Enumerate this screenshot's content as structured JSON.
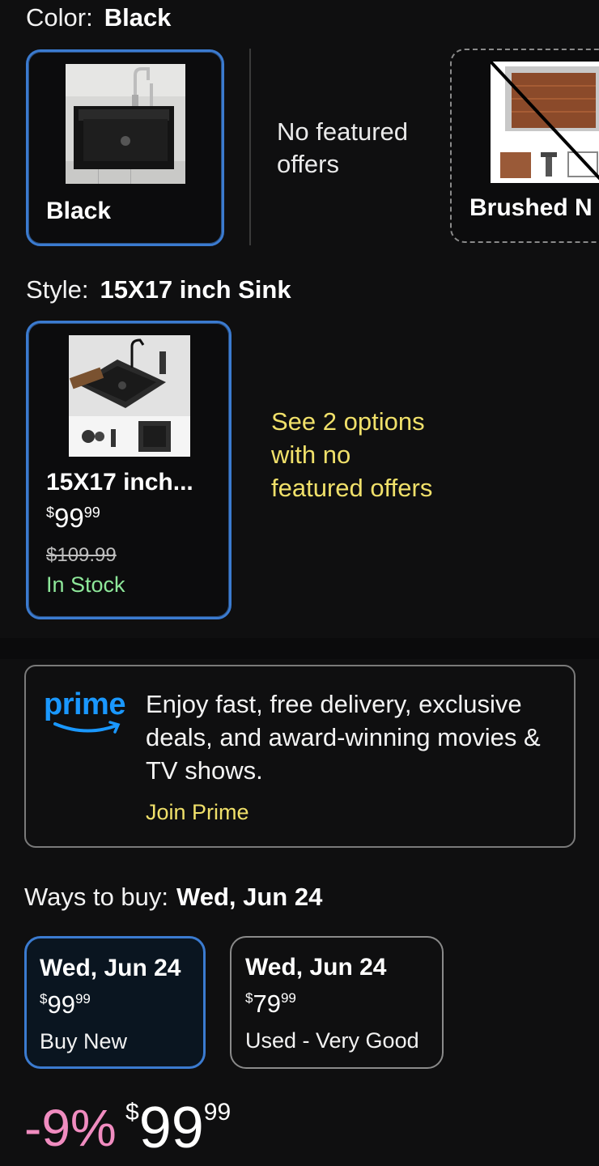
{
  "color": {
    "label": "Color:",
    "selected": "Black",
    "options": [
      {
        "name": "Black"
      },
      {
        "offer_text": "No featured offers"
      },
      {
        "name": "Brushed N"
      }
    ]
  },
  "style": {
    "label": "Style:",
    "selected": "15X17 inch Sink",
    "card": {
      "title": "15X17 inch...",
      "price_dollar": "$",
      "price_whole": "99",
      "price_cents": "99",
      "list_price": "$109.99",
      "availability": "In Stock"
    },
    "see_options": "See 2 options with no featured offers"
  },
  "prime": {
    "logo": "prime",
    "text": "Enjoy fast, free delivery, exclusive deals, and award-winning movies & TV shows.",
    "join": "Join Prime"
  },
  "ways_to_buy": {
    "label": "Ways to buy:",
    "date": "Wed, Jun 24",
    "options": [
      {
        "date": "Wed, Jun 24",
        "dollar": "$",
        "whole": "99",
        "cents": "99",
        "condition": "Buy New",
        "selected": true
      },
      {
        "date": "Wed, Jun 24",
        "dollar": "$",
        "whole": "79",
        "cents": "99",
        "condition": "Used - Very Good",
        "selected": false
      }
    ]
  },
  "price": {
    "discount": "-9%",
    "dollar": "$",
    "whole": "99",
    "cents": "99"
  },
  "colors": {
    "accent_blue": "#3b7bd0",
    "link_yellow": "#f0e06a",
    "in_stock_green": "#8ee89a",
    "discount_pink": "#f08cc0",
    "prime_blue": "#1a98ff"
  }
}
